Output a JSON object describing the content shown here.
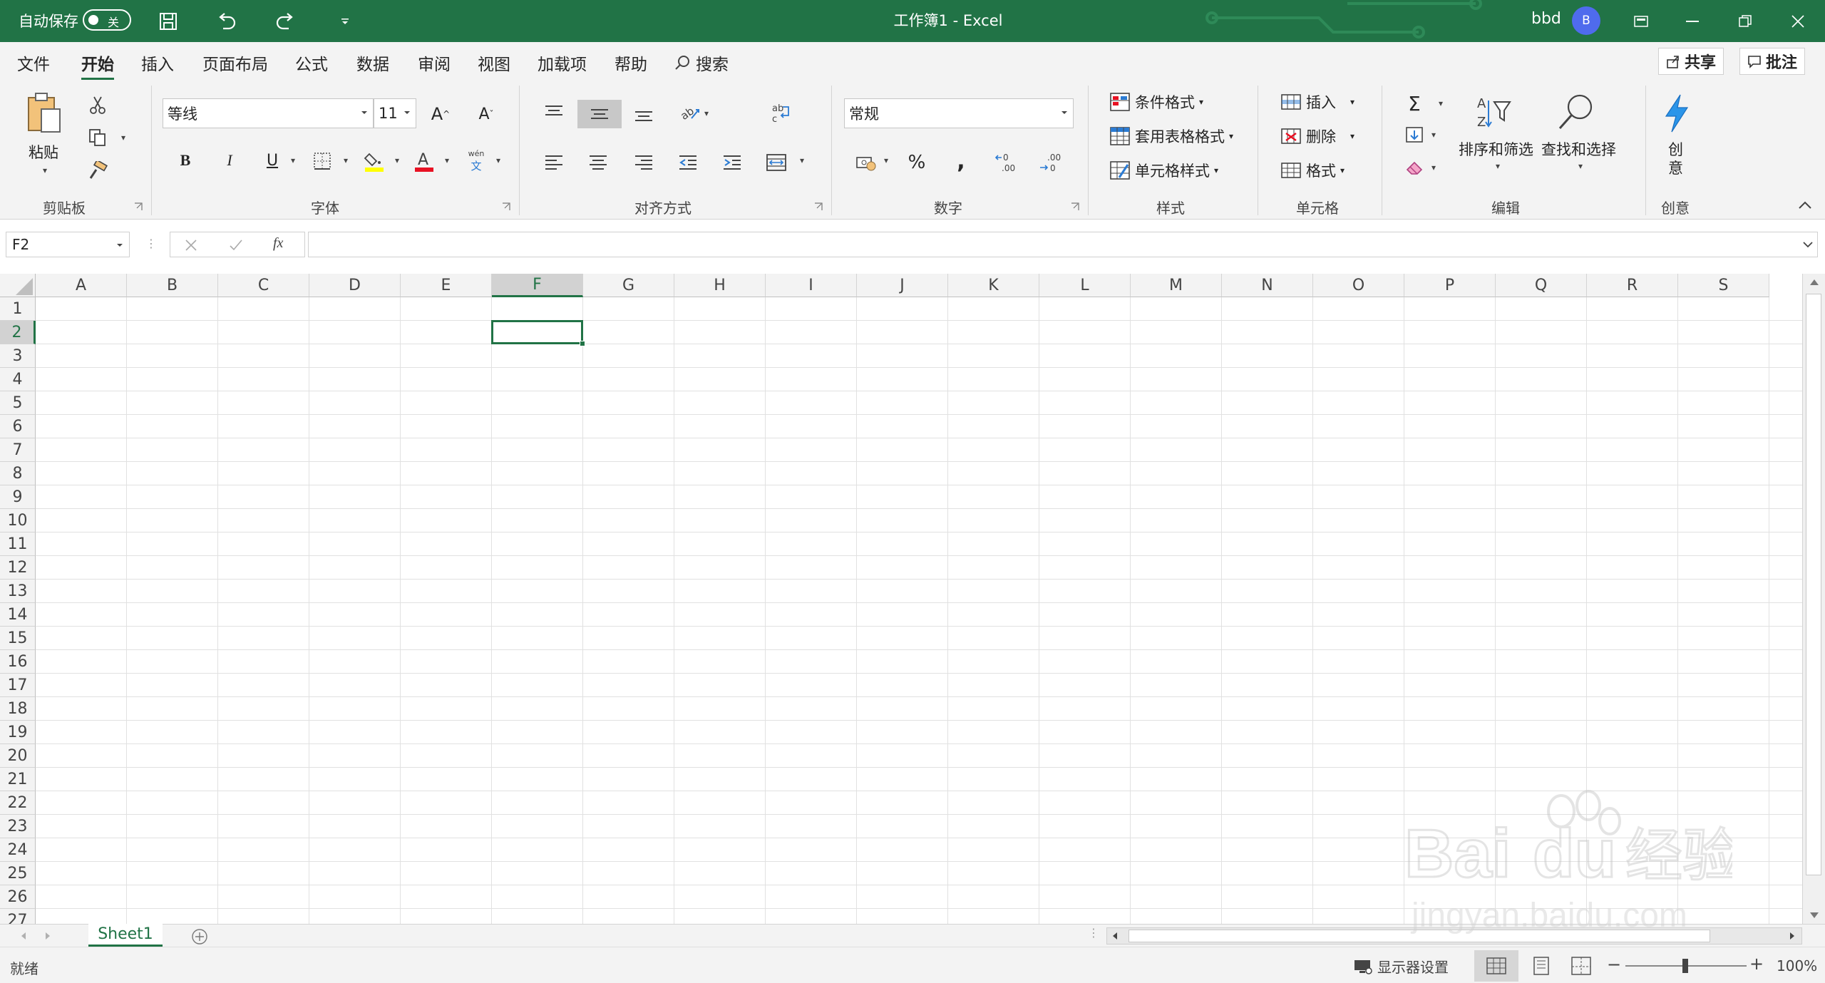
{
  "titlebar": {
    "autosave_label": "自动保存",
    "autosave_state": "关",
    "title": "工作簿1  -  Excel",
    "username": "bbd",
    "avatar_initial": "B"
  },
  "menu": {
    "tabs": [
      "文件",
      "开始",
      "插入",
      "页面布局",
      "公式",
      "数据",
      "审阅",
      "视图",
      "加载项",
      "帮助"
    ],
    "active_tab": "开始",
    "search": "搜索",
    "share": "共享",
    "comments": "批注"
  },
  "ribbon": {
    "clipboard": {
      "label": "剪贴板",
      "paste": "粘贴"
    },
    "font": {
      "label": "字体",
      "font_name": "等线",
      "font_size": "11",
      "phonetic": "wén"
    },
    "alignment": {
      "label": "对齐方式"
    },
    "number": {
      "label": "数字",
      "format": "常规"
    },
    "styles": {
      "label": "样式",
      "conditional": "条件格式",
      "table": "套用表格格式",
      "cell_styles": "单元格样式"
    },
    "cells": {
      "label": "单元格",
      "insert": "插入",
      "delete": "删除",
      "format": "格式"
    },
    "editing": {
      "label": "编辑",
      "sort_filter": "排序和筛选",
      "find_select": "查找和选择"
    },
    "creativity": {
      "label": "创意",
      "btn_line1": "创",
      "btn_line2": "意"
    }
  },
  "formula_bar": {
    "name_box": "F2",
    "fx": "fx",
    "value": ""
  },
  "grid": {
    "columns": [
      "A",
      "B",
      "C",
      "D",
      "E",
      "F",
      "G",
      "H",
      "I",
      "J",
      "K",
      "L",
      "M",
      "N",
      "O",
      "P",
      "Q",
      "R",
      "S"
    ],
    "rows": [
      "1",
      "2",
      "3",
      "4",
      "5",
      "6",
      "7",
      "8",
      "9",
      "10",
      "11",
      "12",
      "13",
      "14",
      "15",
      "16",
      "17",
      "18",
      "19",
      "20",
      "21",
      "22",
      "23",
      "24",
      "25",
      "26",
      "27"
    ],
    "selected_column": "F",
    "selected_row": "2"
  },
  "sheets": {
    "tabs": [
      "Sheet1"
    ],
    "active": "Sheet1"
  },
  "statusbar": {
    "ready": "就绪",
    "display_settings": "显示器设置",
    "zoom": "100%"
  },
  "watermark": {
    "brand": "Bai du 经验",
    "url": "jingyan.baidu.com"
  },
  "colors": {
    "accent": "#217346",
    "avatar": "#4f6bed"
  }
}
